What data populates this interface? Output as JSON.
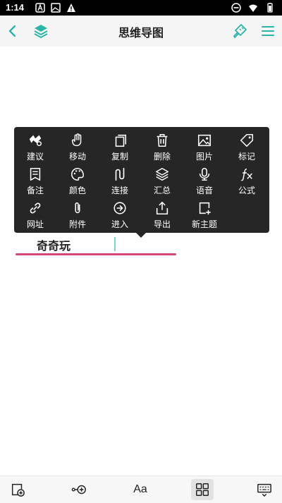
{
  "status_bar": {
    "time": "1:14"
  },
  "header": {
    "title": "思维导图"
  },
  "context_menu": {
    "rows": [
      [
        {
          "label": "建议",
          "icon": "suggest-icon"
        },
        {
          "label": "移动",
          "icon": "hand-icon"
        },
        {
          "label": "复制",
          "icon": "copy-icon"
        },
        {
          "label": "删除",
          "icon": "trash-icon"
        },
        {
          "label": "图片",
          "icon": "image-icon"
        },
        {
          "label": "标记",
          "icon": "tag-icon"
        }
      ],
      [
        {
          "label": "备注",
          "icon": "note-icon"
        },
        {
          "label": "颜色",
          "icon": "palette-icon"
        },
        {
          "label": "连接",
          "icon": "connect-icon"
        },
        {
          "label": "汇总",
          "icon": "layers-icon"
        },
        {
          "label": "语音",
          "icon": "mic-icon"
        },
        {
          "label": "公式",
          "icon": "formula-icon"
        }
      ],
      [
        {
          "label": "网址",
          "icon": "link-icon"
        },
        {
          "label": "附件",
          "icon": "paperclip-icon"
        },
        {
          "label": "进入",
          "icon": "enter-icon"
        },
        {
          "label": "导出",
          "icon": "export-icon"
        },
        {
          "label": "新主题",
          "icon": "new-topic-icon"
        }
      ]
    ]
  },
  "topic": {
    "text": "奇奇玩"
  },
  "bottom_toolbar": {
    "font_label": "Aa",
    "items": [
      "add-topic-icon",
      "add-subtopic-icon",
      "font-icon",
      "layout-grid-icon",
      "keyboard-icon"
    ]
  },
  "colors": {
    "accent": "#2bb5a6",
    "menu_bg": "#262626",
    "underline": "#d6457a"
  }
}
